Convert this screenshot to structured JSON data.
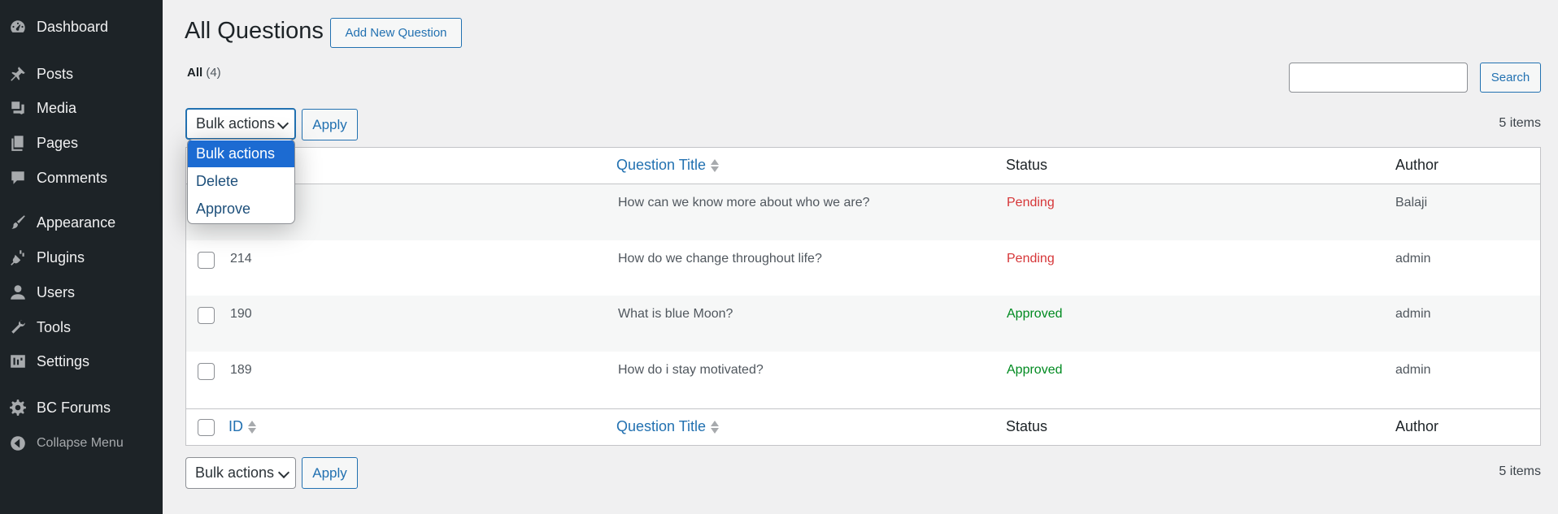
{
  "sidebar": {
    "items": [
      {
        "label": "Dashboard",
        "icon": "dashboard-icon"
      },
      {
        "label": "Posts",
        "icon": "pin-icon"
      },
      {
        "label": "Media",
        "icon": "media-icon"
      },
      {
        "label": "Pages",
        "icon": "pages-icon"
      },
      {
        "label": "Comments",
        "icon": "comment-icon"
      },
      {
        "label": "Appearance",
        "icon": "brush-icon"
      },
      {
        "label": "Plugins",
        "icon": "plugin-icon"
      },
      {
        "label": "Users",
        "icon": "user-icon"
      },
      {
        "label": "Tools",
        "icon": "wrench-icon"
      },
      {
        "label": "Settings",
        "icon": "settings-icon"
      },
      {
        "label": "BC Forums",
        "icon": "gear-icon"
      },
      {
        "label": "Collapse Menu",
        "icon": "collapse-icon"
      }
    ]
  },
  "header": {
    "title": "All Questions",
    "add_new_label": "Add New Question"
  },
  "filters": {
    "all_label": "All",
    "all_count": "(4)"
  },
  "search": {
    "placeholder": "",
    "button_label": "Search"
  },
  "bulk": {
    "selected": "Bulk actions",
    "apply_label": "Apply",
    "options": [
      "Bulk actions",
      "Delete",
      "Approve"
    ]
  },
  "items_count": "5 items",
  "table": {
    "columns": [
      "ID",
      "Question Title",
      "Status",
      "Author"
    ],
    "rows": [
      {
        "id": "",
        "title": "How can we know more about who we are?",
        "status": "Pending",
        "author": "Balaji"
      },
      {
        "id": "214",
        "title": "How do we change throughout life?",
        "status": "Pending",
        "author": "admin"
      },
      {
        "id": "190",
        "title": "What is blue Moon?",
        "status": "Approved",
        "author": "admin"
      },
      {
        "id": "189",
        "title": "How do i stay motivated?",
        "status": "Approved",
        "author": "admin"
      }
    ]
  },
  "colors": {
    "accent": "#2271b1",
    "pending": "#d63638",
    "approved": "#008a20",
    "sidebar": "#1d2327",
    "dropdown_selected": "#1c6bd2"
  }
}
